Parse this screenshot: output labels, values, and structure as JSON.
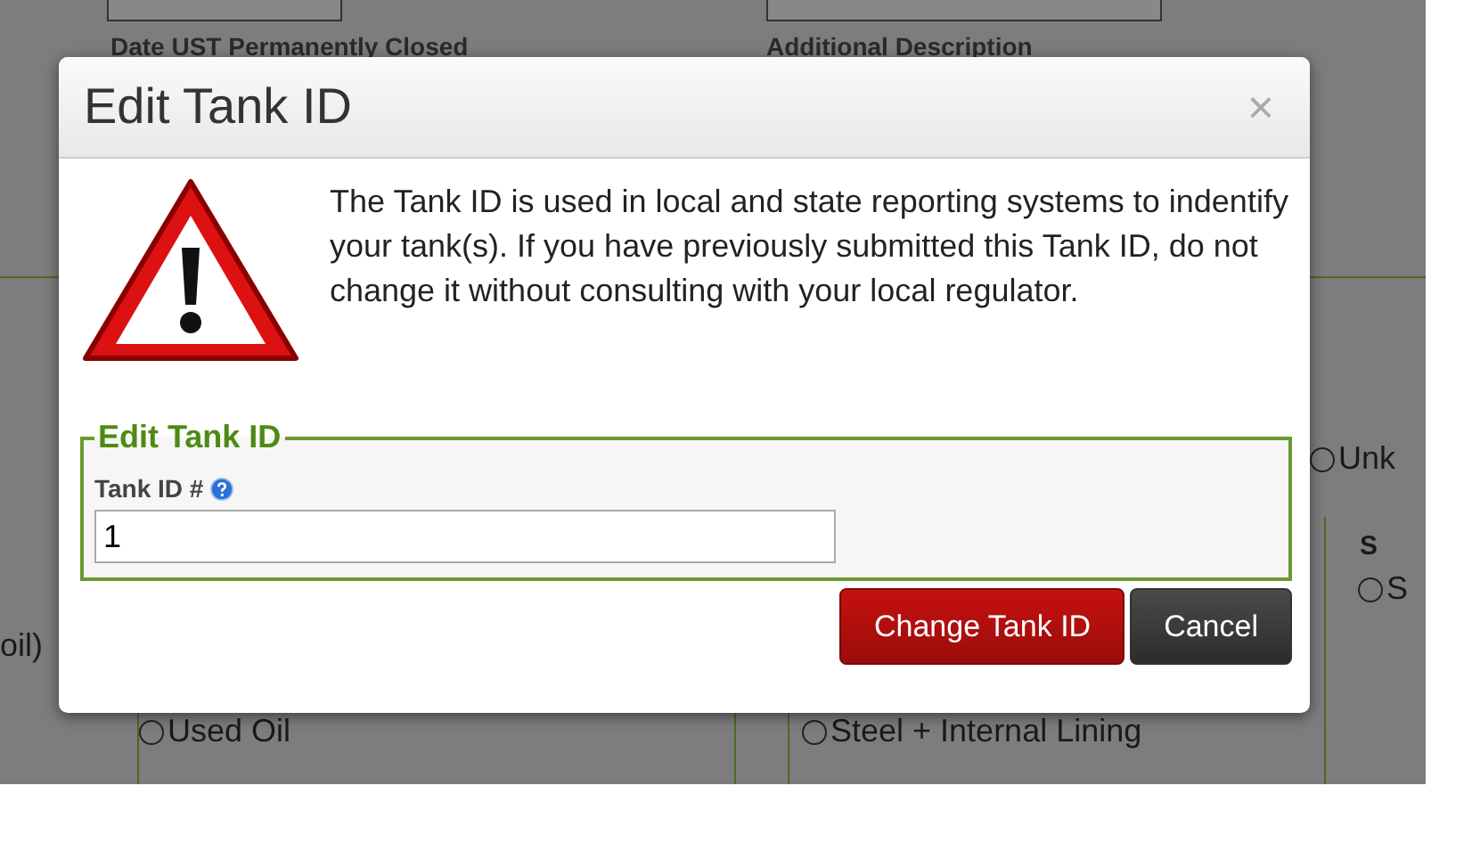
{
  "background": {
    "headings": [
      "Date UST Permanently Closed",
      "Additional Description"
    ],
    "fragment": "oil)",
    "radios": [
      {
        "label": "Unk",
        "selected": false
      },
      {
        "label": "Used Oil",
        "selected": false
      },
      {
        "label": "Steel + Internal Lining",
        "selected": false
      },
      {
        "label": "S",
        "selected": false
      }
    ],
    "column_heading": "S"
  },
  "dialog": {
    "title": "Edit Tank ID",
    "close": "×",
    "message": "The Tank ID is used in local and state reporting systems to indentify your tank(s). If you have previously submitted this Tank ID, do not change it without consulting with your local regulator.",
    "fieldset": {
      "legend": "Edit Tank ID",
      "label": "Tank ID #",
      "value": "1"
    },
    "buttons": [
      {
        "label": "Change Tank ID",
        "kind": "primary"
      },
      {
        "label": "Cancel",
        "kind": "secondary"
      }
    ]
  }
}
